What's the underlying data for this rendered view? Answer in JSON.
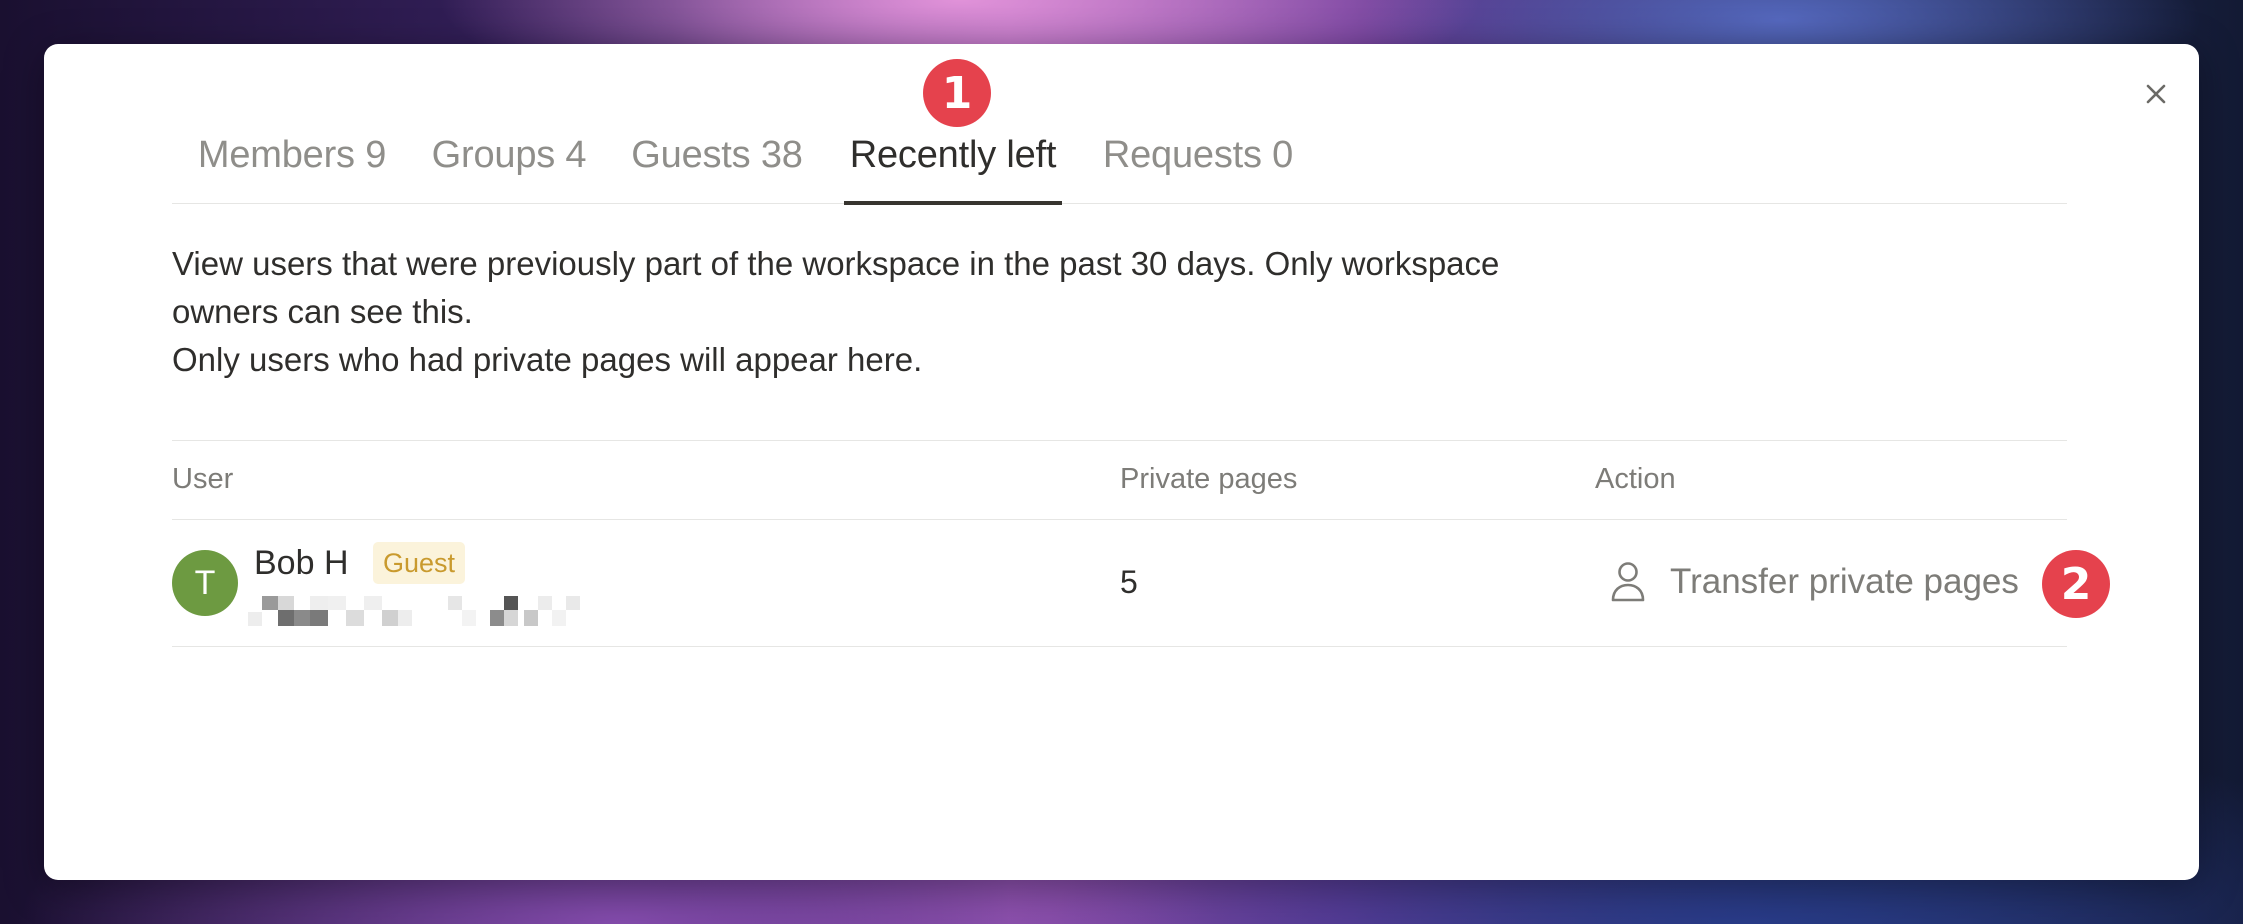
{
  "dialog": {
    "close_symbol": "×",
    "close_icon": "close-icon"
  },
  "tabs": [
    {
      "label": "Members",
      "count": "9",
      "active": false
    },
    {
      "label": "Groups",
      "count": "4",
      "active": false
    },
    {
      "label": "Guests",
      "count": "38",
      "active": false
    },
    {
      "label": "Recently left",
      "count": "",
      "active": true
    },
    {
      "label": "Requests",
      "count": "0",
      "active": false
    }
  ],
  "annotations": {
    "step1": "1",
    "step2": "2",
    "color": "#e5424d"
  },
  "description": {
    "line1": "View users that were previously part of the workspace in the past 30 days. Only workspace owners can see this.",
    "line2": "Only users who had private pages will appear here."
  },
  "table": {
    "headers": {
      "user": "User",
      "private_pages": "Private pages",
      "action": "Action"
    },
    "rows": [
      {
        "avatar_initial": "T",
        "avatar_color": "#6d9a41",
        "name": "Bob H",
        "role": "Guest",
        "email_redacted": true,
        "private_pages": "5",
        "action_label": "Transfer private pages",
        "action_icon": "user-icon"
      }
    ]
  },
  "colors": {
    "text": "#2f2e2c",
    "muted": "#8f8e8a",
    "guest_tag_bg": "#fbf3db",
    "guest_tag_text": "#c99a2e"
  }
}
